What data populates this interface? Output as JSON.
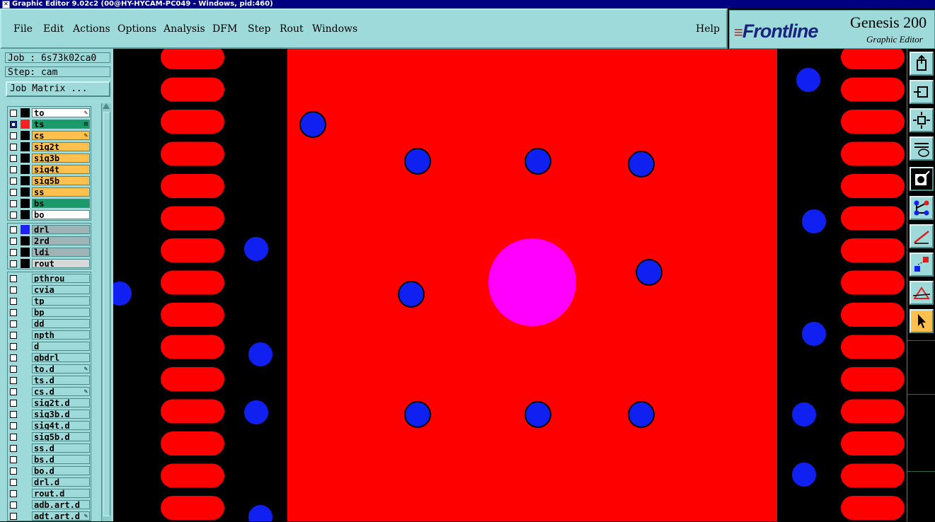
{
  "window": {
    "title": "Graphic Editor 9.02c2 (00@HY-HYCAM-PC049 - Windows, pid:460)"
  },
  "menu": {
    "items": [
      {
        "label": "File"
      },
      {
        "label": "Edit"
      },
      {
        "label": "Actions"
      },
      {
        "label": "Options"
      },
      {
        "label": "Analysis"
      },
      {
        "label": "DFM"
      },
      {
        "label": "Step"
      },
      {
        "label": "Rout"
      },
      {
        "label": "Windows"
      }
    ],
    "help": "Help"
  },
  "logo": {
    "brand": "Frontline",
    "product": "Genesis 200",
    "subtitle": "Graphic Editor"
  },
  "job": {
    "job_line": "Job : 6s73k02ca0",
    "step_line": "Step: cam",
    "matrix_button": "Job Matrix ..."
  },
  "layers": {
    "board": [
      {
        "name": "to",
        "bg": "#ffffff",
        "color": "",
        "mark": "✎"
      },
      {
        "name": "ts",
        "bg": "#1a9a6a",
        "color": "#ff2020",
        "mark": "⊞",
        "checked": true
      },
      {
        "name": "cs",
        "bg": "#ffc04d",
        "color": "",
        "mark": "✎"
      },
      {
        "name": "sig2t",
        "bg": "#ffc04d",
        "color": ""
      },
      {
        "name": "sig3b",
        "bg": "#ffc04d",
        "color": ""
      },
      {
        "name": "sig4t",
        "bg": "#ffc04d",
        "color": ""
      },
      {
        "name": "sig5b",
        "bg": "#ffc04d",
        "color": ""
      },
      {
        "name": "ss",
        "bg": "#ffc04d",
        "color": ""
      },
      {
        "name": "bs",
        "bg": "#1a9a6a",
        "color": ""
      },
      {
        "name": "bo",
        "bg": "#ffffff",
        "color": ""
      }
    ],
    "drill": [
      {
        "name": "drl",
        "bg": "#a0b4b8",
        "color": "#2020ff"
      },
      {
        "name": "2rd",
        "bg": "#a0b4b8",
        "color": ""
      },
      {
        "name": "ldi",
        "bg": "#a0b4b8",
        "color": ""
      },
      {
        "name": "rout",
        "bg": "#d8d8d8",
        "color": ""
      }
    ],
    "misc": [
      {
        "name": "pthrou"
      },
      {
        "name": "cvia"
      },
      {
        "name": "tp"
      },
      {
        "name": "bp"
      },
      {
        "name": "dd"
      },
      {
        "name": "npth"
      },
      {
        "name": "d"
      },
      {
        "name": "gbdrl"
      },
      {
        "name": "to.d",
        "mark": "✎"
      },
      {
        "name": "ts.d"
      },
      {
        "name": "cs.d",
        "mark": "✎"
      },
      {
        "name": "sig2t.d"
      },
      {
        "name": "sig3b.d"
      },
      {
        "name": "sig4t.d"
      },
      {
        "name": "sig5b.d"
      },
      {
        "name": "ss.d"
      },
      {
        "name": "bs.d"
      },
      {
        "name": "bo.d"
      },
      {
        "name": "drl.d"
      },
      {
        "name": "rout.d"
      },
      {
        "name": "adb.art.d"
      },
      {
        "name": "adt.art.d",
        "mark": "✎"
      }
    ]
  },
  "canvas": {
    "background": "#000000",
    "pad_color": "#ff0000",
    "via_color": "#1020f0",
    "hole_color": "#ff00ff"
  },
  "toolbar": {
    "tools": [
      {
        "icon": "export-icon"
      },
      {
        "icon": "window-select-icon"
      },
      {
        "icon": "zoom-fit-icon"
      },
      {
        "icon": "settings-palette-icon"
      },
      {
        "icon": "feature-snap-icon"
      },
      {
        "icon": "net-connect-icon"
      },
      {
        "icon": "measure-icon"
      },
      {
        "icon": "move-feature-icon"
      },
      {
        "icon": "dfm-check-icon"
      },
      {
        "icon": "pointer-select-icon",
        "active": true
      }
    ]
  }
}
